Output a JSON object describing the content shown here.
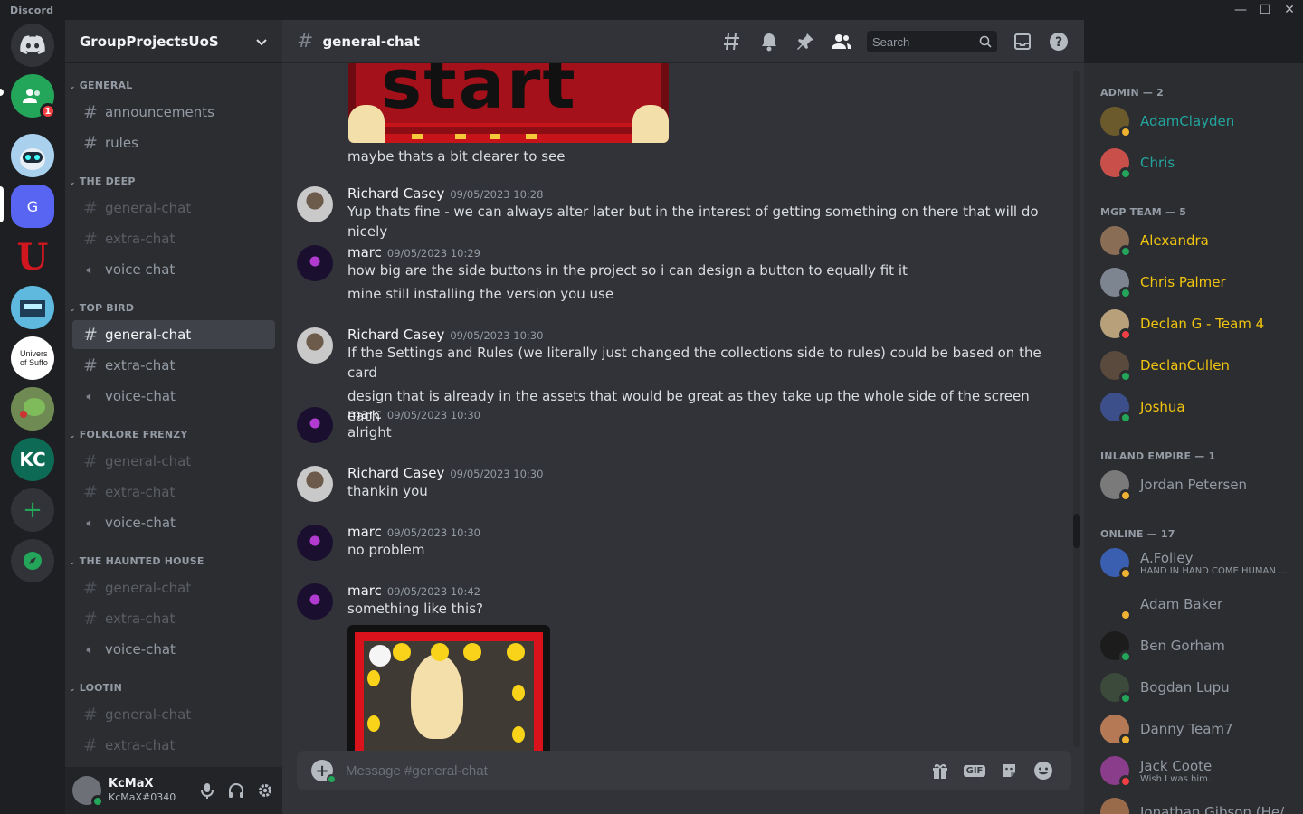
{
  "window": {
    "app_name": "Discord"
  },
  "colors": {
    "online": "#23a55a",
    "idle": "#f0b232",
    "dnd": "#f23f43",
    "admin": "#23a59e",
    "mgp": "#f1c40f",
    "blurple": "#5865f2",
    "green": "#23a55a"
  },
  "rail": {
    "servers": [
      {
        "name": "home",
        "initial": ""
      },
      {
        "name": "friends",
        "initial": "",
        "badge": "1"
      },
      {
        "name": "robot-server",
        "initial": ""
      },
      {
        "name": "group-projects",
        "initial": "G"
      },
      {
        "name": "u-server",
        "initial": "U"
      },
      {
        "name": "pixel-server",
        "initial": ""
      },
      {
        "name": "university-server",
        "initial": "Univers of Suffo"
      },
      {
        "name": "frog-server",
        "initial": ""
      },
      {
        "name": "kc-server",
        "initial": "KC"
      }
    ]
  },
  "guild": {
    "name": "GroupProjectsUoS"
  },
  "categories": [
    {
      "label": "GENERAL",
      "channels": [
        {
          "name": "announcements",
          "type": "text"
        },
        {
          "name": "rules",
          "type": "text"
        }
      ]
    },
    {
      "label": "THE DEEP",
      "channels": [
        {
          "name": "general-chat",
          "type": "text"
        },
        {
          "name": "extra-chat",
          "type": "text"
        },
        {
          "name": "voice chat",
          "type": "voice"
        }
      ]
    },
    {
      "label": "TOP BIRD",
      "channels": [
        {
          "name": "general-chat",
          "type": "text",
          "active": true
        },
        {
          "name": "extra-chat",
          "type": "text"
        },
        {
          "name": "voice-chat",
          "type": "voice"
        }
      ]
    },
    {
      "label": "FOLKLORE FRENZY",
      "channels": [
        {
          "name": "general-chat",
          "type": "text"
        },
        {
          "name": "extra-chat",
          "type": "text"
        },
        {
          "name": "voice-chat",
          "type": "voice"
        }
      ]
    },
    {
      "label": "THE HAUNTED HOUSE",
      "channels": [
        {
          "name": "general-chat",
          "type": "text"
        },
        {
          "name": "extra-chat",
          "type": "text"
        },
        {
          "name": "voice-chat",
          "type": "voice"
        }
      ]
    },
    {
      "label": "LOOTIN",
      "channels": [
        {
          "name": "general-chat",
          "type": "text"
        },
        {
          "name": "extra-chat",
          "type": "text"
        }
      ]
    }
  ],
  "user": {
    "name": "KcMaX",
    "tag": "KcMaX#0340"
  },
  "chat": {
    "channel": "general-chat",
    "search_placeholder": "Search",
    "composer_placeholder": "Message #general-chat",
    "top_image_text": "start",
    "messages": [
      {
        "author": "",
        "time": "",
        "lines": [
          "maybe thats a bit clearer to see"
        ]
      },
      {
        "author": "Richard Casey",
        "time": "09/05/2023 10:28",
        "lines": [
          "Yup thats fine - we can always alter later but in the interest of getting something on there that will do nicely"
        ]
      },
      {
        "author": "marc",
        "time": "09/05/2023 10:29",
        "lines": [
          "how big are the side buttons in the project so i can design a button to equally fit it",
          "mine still installing the version you use"
        ]
      },
      {
        "author": "Richard Casey",
        "time": "09/05/2023 10:30",
        "lines": [
          "If the Settings and Rules (we literally just changed the collections side to rules) could be based on the card",
          "design that is already in the assets that would be great as they take up the whole side of the screen each"
        ]
      },
      {
        "author": "marc",
        "time": "09/05/2023 10:30",
        "lines": [
          "alright"
        ]
      },
      {
        "author": "Richard Casey",
        "time": "09/05/2023 10:30",
        "lines": [
          "thankin you"
        ]
      },
      {
        "author": "marc",
        "time": "09/05/2023 10:30",
        "lines": [
          "no problem"
        ]
      },
      {
        "author": "marc",
        "time": "09/05/2023 10:42",
        "lines": [
          "something like this?"
        ]
      }
    ]
  },
  "members": {
    "groups": [
      {
        "label": "ADMIN — 2",
        "members": [
          {
            "name": "AdamClayden",
            "status": "idle",
            "color": "admin"
          },
          {
            "name": "Chris",
            "status": "online",
            "color": "admin"
          }
        ]
      },
      {
        "label": "MGP TEAM — 5",
        "members": [
          {
            "name": "Alexandra",
            "status": "online",
            "color": "mgp"
          },
          {
            "name": "Chris Palmer",
            "status": "online",
            "color": "mgp"
          },
          {
            "name": "Declan G - Team 4",
            "status": "dnd",
            "color": "mgp"
          },
          {
            "name": "DeclanCullen",
            "status": "online",
            "color": "mgp"
          },
          {
            "name": "Joshua",
            "status": "online",
            "color": "mgp"
          }
        ]
      },
      {
        "label": "INLAND EMPIRE — 1",
        "members": [
          {
            "name": "Jordan Petersen",
            "status": "idle",
            "color": "plain"
          }
        ]
      },
      {
        "label": "ONLINE — 17",
        "members": [
          {
            "name": "A.Folley",
            "status": "idle",
            "color": "plain",
            "sub": "HAND IN HAND COME HUMAN ..."
          },
          {
            "name": "Adam Baker",
            "status": "idle",
            "color": "plain"
          },
          {
            "name": "Ben Gorham",
            "status": "online",
            "color": "plain"
          },
          {
            "name": "Bogdan Lupu",
            "status": "online",
            "color": "plain"
          },
          {
            "name": "Danny Team7",
            "status": "idle",
            "color": "plain"
          },
          {
            "name": "Jack Coote",
            "status": "dnd",
            "color": "plain",
            "sub": "Wish I was him."
          },
          {
            "name": "Jonathan Gibson (He/",
            "status": "online",
            "color": "plain"
          }
        ]
      }
    ]
  }
}
